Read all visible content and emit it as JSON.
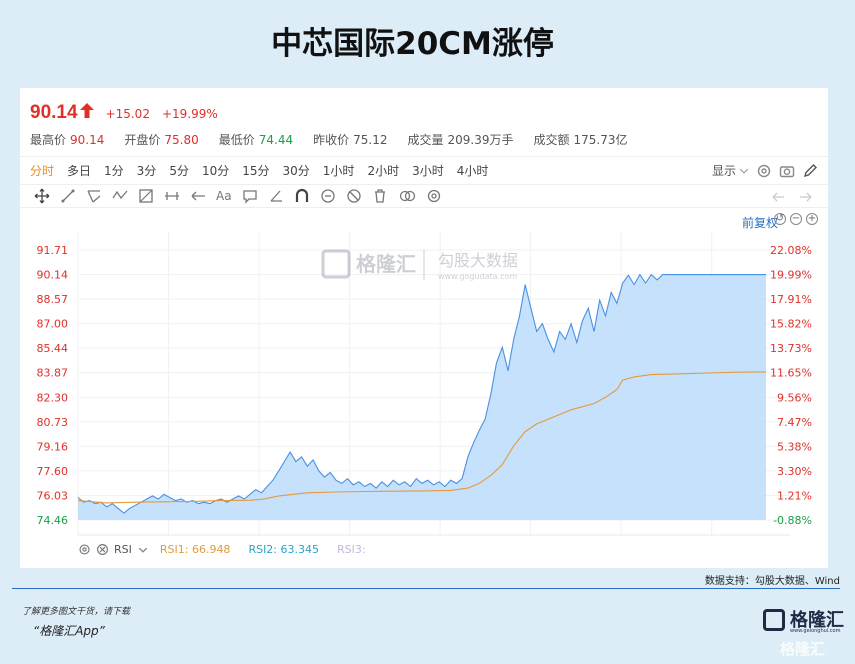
{
  "headline": "中芯国际20CM涨停",
  "quote": {
    "price": "90.14",
    "change": "+15.02",
    "change_pct": "+19.99%"
  },
  "stats": [
    {
      "label": "最高价",
      "value": "90.14",
      "color": "#e0302a"
    },
    {
      "label": "开盘价",
      "value": "75.80",
      "color": "#e0302a"
    },
    {
      "label": "最低价",
      "value": "74.44",
      "color": "#1aa04a"
    },
    {
      "label": "昨收价",
      "value": "75.12",
      "color": "#555555"
    },
    {
      "label": "成交量",
      "value": "209.39万手",
      "color": "#555555"
    },
    {
      "label": "成交额",
      "value": "175.73亿",
      "color": "#555555"
    }
  ],
  "tabs": [
    "分时",
    "多日",
    "1分",
    "3分",
    "5分",
    "10分",
    "15分",
    "30分",
    "1小时",
    "2小时",
    "3小时",
    "4小时"
  ],
  "active_tab": "分时",
  "display_label": "显示",
  "text_tool": "Aa",
  "adjust_label": "前复权",
  "watermark": {
    "cn": "格隆汇",
    "cn2": "勾股大数据",
    "url": "www.gogudata.com"
  },
  "rsi": {
    "label": "RSI",
    "rsi1": "RSI1: 66.948",
    "rsi2": "RSI2: 63.345",
    "rsi3": "RSI3:"
  },
  "support": "数据支持：勾股大数据、Wind",
  "footer": {
    "line1": "了解更多图文干货，请下载",
    "line2": "“格隆汇App”",
    "logo": "格隆汇",
    "logo_sub": "www.gelonghui.com",
    "watermark2": "格隆汇"
  },
  "colors": {
    "up": "#e0302a",
    "down": "#1aa04a",
    "price_line": "#4a90e2",
    "avg_line": "#e39a3c",
    "area": "#bcdcfa"
  },
  "chart_data": {
    "type": "area",
    "title": "",
    "y_ticks": [
      "91.71",
      "90.14",
      "88.57",
      "87.00",
      "85.44",
      "83.87",
      "82.30",
      "80.73",
      "79.16",
      "77.60",
      "76.03",
      "74.46"
    ],
    "y_pct_ticks": [
      "22.08%",
      "19.99%",
      "17.91%",
      "15.82%",
      "13.73%",
      "11.65%",
      "9.56%",
      "7.47%",
      "5.38%",
      "3.30%",
      "1.21%",
      "-0.88%"
    ],
    "ylim": [
      74.46,
      91.71
    ],
    "xlim": [
      0,
      240
    ],
    "series": [
      {
        "values": [
          [
            0,
            75.9
          ],
          [
            2,
            75.6
          ],
          [
            4,
            75.7
          ],
          [
            6,
            75.5
          ],
          [
            8,
            75.6
          ],
          [
            10,
            75.3
          ],
          [
            12,
            75.5
          ],
          [
            14,
            75.2
          ],
          [
            16,
            74.9
          ],
          [
            18,
            75.2
          ],
          [
            20,
            75.4
          ],
          [
            22,
            75.6
          ],
          [
            24,
            75.8
          ],
          [
            26,
            76.0
          ],
          [
            28,
            75.8
          ],
          [
            30,
            76.1
          ],
          [
            32,
            75.9
          ],
          [
            34,
            75.7
          ],
          [
            36,
            75.8
          ],
          [
            38,
            75.6
          ],
          [
            40,
            75.7
          ],
          [
            42,
            75.5
          ],
          [
            44,
            75.6
          ],
          [
            46,
            75.5
          ],
          [
            48,
            75.7
          ],
          [
            50,
            75.8
          ],
          [
            52,
            75.6
          ],
          [
            54,
            75.8
          ],
          [
            56,
            76.0
          ],
          [
            58,
            75.8
          ],
          [
            60,
            76.1
          ],
          [
            62,
            76.4
          ],
          [
            64,
            76.2
          ],
          [
            66,
            76.6
          ],
          [
            68,
            77.0
          ],
          [
            70,
            77.6
          ],
          [
            72,
            78.2
          ],
          [
            74,
            78.8
          ],
          [
            76,
            78.2
          ],
          [
            78,
            78.5
          ],
          [
            80,
            77.9
          ],
          [
            82,
            78.3
          ],
          [
            84,
            77.6
          ],
          [
            86,
            77.2
          ],
          [
            88,
            77.5
          ],
          [
            90,
            77.0
          ],
          [
            92,
            76.8
          ],
          [
            94,
            77.1
          ],
          [
            96,
            76.7
          ],
          [
            98,
            76.9
          ],
          [
            100,
            76.6
          ],
          [
            102,
            76.8
          ],
          [
            104,
            76.5
          ],
          [
            106,
            76.9
          ],
          [
            108,
            76.6
          ],
          [
            110,
            77.0
          ],
          [
            112,
            76.7
          ],
          [
            114,
            76.9
          ],
          [
            116,
            76.6
          ],
          [
            118,
            77.1
          ],
          [
            120,
            76.8
          ],
          [
            122,
            77.0
          ],
          [
            124,
            76.7
          ],
          [
            126,
            76.9
          ],
          [
            128,
            76.6
          ],
          [
            130,
            77.0
          ],
          [
            132,
            76.8
          ],
          [
            134,
            77.1
          ],
          [
            136,
            78.5
          ],
          [
            138,
            79.4
          ],
          [
            140,
            80.2
          ],
          [
            142,
            80.9
          ],
          [
            144,
            82.5
          ],
          [
            146,
            84.5
          ],
          [
            148,
            85.5
          ],
          [
            150,
            84.0
          ],
          [
            152,
            86.0
          ],
          [
            154,
            87.5
          ],
          [
            156,
            89.5
          ],
          [
            158,
            88.0
          ],
          [
            160,
            86.5
          ],
          [
            162,
            87.0
          ],
          [
            164,
            86.0
          ],
          [
            166,
            85.2
          ],
          [
            168,
            86.5
          ],
          [
            170,
            86.0
          ],
          [
            172,
            87.0
          ],
          [
            174,
            85.8
          ],
          [
            176,
            87.2
          ],
          [
            178,
            88.0
          ],
          [
            180,
            86.5
          ],
          [
            182,
            88.5
          ],
          [
            184,
            87.5
          ],
          [
            186,
            89.0
          ],
          [
            188,
            88.3
          ],
          [
            190,
            89.6
          ],
          [
            192,
            90.1
          ],
          [
            194,
            89.5
          ],
          [
            196,
            90.14
          ],
          [
            198,
            89.6
          ],
          [
            200,
            90.14
          ],
          [
            202,
            89.8
          ],
          [
            204,
            90.14
          ],
          [
            206,
            90.14
          ],
          [
            210,
            90.14
          ],
          [
            220,
            90.14
          ],
          [
            230,
            90.14
          ],
          [
            240,
            90.14
          ]
        ]
      },
      {
        "values": [
          [
            0,
            75.7
          ],
          [
            10,
            75.55
          ],
          [
            20,
            75.6
          ],
          [
            30,
            75.62
          ],
          [
            40,
            75.65
          ],
          [
            50,
            75.7
          ],
          [
            60,
            75.72
          ],
          [
            65,
            75.8
          ],
          [
            70,
            76.0
          ],
          [
            80,
            76.2
          ],
          [
            90,
            76.25
          ],
          [
            100,
            76.28
          ],
          [
            110,
            76.3
          ],
          [
            120,
            76.32
          ],
          [
            130,
            76.35
          ],
          [
            136,
            76.5
          ],
          [
            140,
            76.8
          ],
          [
            144,
            77.3
          ],
          [
            148,
            78.0
          ],
          [
            152,
            79.2
          ],
          [
            156,
            80.1
          ],
          [
            160,
            80.6
          ],
          [
            164,
            80.9
          ],
          [
            168,
            81.2
          ],
          [
            172,
            81.5
          ],
          [
            176,
            81.7
          ],
          [
            180,
            81.9
          ],
          [
            184,
            82.3
          ],
          [
            188,
            82.8
          ],
          [
            190,
            83.4
          ],
          [
            194,
            83.6
          ],
          [
            200,
            83.75
          ],
          [
            210,
            83.8
          ],
          [
            220,
            83.85
          ],
          [
            230,
            83.9
          ],
          [
            240,
            83.92
          ]
        ]
      }
    ]
  }
}
